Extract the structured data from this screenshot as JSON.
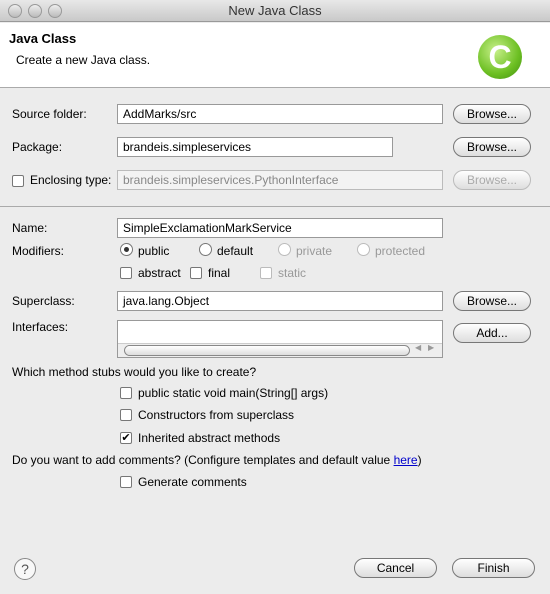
{
  "window": {
    "title": "New Java Class"
  },
  "header": {
    "title": "Java Class",
    "description": "Create a new Java class.",
    "logo_letter": "C"
  },
  "source_folder": {
    "label": "Source folder:",
    "value": "AddMarks/src",
    "button": "Browse..."
  },
  "package": {
    "label": "Package:",
    "value": "brandeis.simpleservices",
    "button": "Browse..."
  },
  "enclosing_type": {
    "label": "Enclosing type:",
    "checked": false,
    "value": "brandeis.simpleservices.PythonInterface",
    "button": "Browse..."
  },
  "name": {
    "label": "Name:",
    "value": "SimpleExclamationMarkService"
  },
  "modifiers": {
    "label": "Modifiers:",
    "access": [
      {
        "label": "public",
        "selected": true
      },
      {
        "label": "default",
        "selected": false
      },
      {
        "label": "private",
        "selected": false,
        "disabled": true
      },
      {
        "label": "protected",
        "selected": false,
        "disabled": true
      }
    ],
    "flags": [
      {
        "label": "abstract",
        "checked": false
      },
      {
        "label": "final",
        "checked": false
      },
      {
        "label": "static",
        "checked": false,
        "disabled": true
      }
    ]
  },
  "superclass": {
    "label": "Superclass:",
    "value": "java.lang.Object",
    "button": "Browse..."
  },
  "interfaces": {
    "label": "Interfaces:",
    "button": "Add..."
  },
  "stubs": {
    "question": "Which method stubs would you like to create?",
    "options": [
      {
        "label": "public static void main(String[] args)",
        "checked": false
      },
      {
        "label": "Constructors from superclass",
        "checked": false
      },
      {
        "label": "Inherited abstract methods",
        "checked": true
      }
    ]
  },
  "comments": {
    "question": "Do you want to add comments? (Configure templates and default value ",
    "link": "here",
    "suffix": ")",
    "option": "Generate comments",
    "checked": false
  },
  "footer": {
    "help": "?",
    "cancel": "Cancel",
    "finish": "Finish"
  }
}
